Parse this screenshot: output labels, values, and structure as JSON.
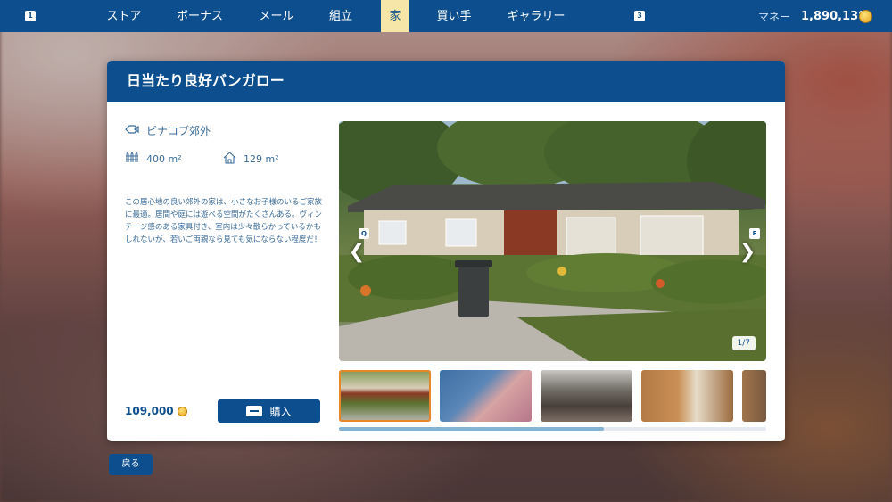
{
  "topbar": {
    "key_left": "1",
    "key_right": "3",
    "nav": [
      {
        "label": "ストア",
        "active": false
      },
      {
        "label": "ボーナス",
        "active": false
      },
      {
        "label": "メール",
        "active": false
      },
      {
        "label": "組立",
        "active": false
      },
      {
        "label": "家",
        "active": true
      },
      {
        "label": "買い手",
        "active": false
      },
      {
        "label": "ギャラリー",
        "active": false
      }
    ],
    "money_label": "マネー",
    "money_value": "1,890,138"
  },
  "dialog": {
    "title": "日当たり良好バンガロー",
    "location": "ピナコブ郊外",
    "plot_area": "400 m²",
    "house_area": "129 m²",
    "description": "この居心地の良い郊外の家は、小さなお子様のいるご家族に最適。居間や庭には遊べる空間がたくさんある。ヴィンテージ感のある家具付き、室内は少々散らかっているかもしれないが、若いご両親なら見ても気にならない程度だ！",
    "price": "109,000",
    "buy_label": "購入",
    "gallery": {
      "prev_key": "Q",
      "next_key": "E",
      "prev_arrow": "❮",
      "next_arrow": "❯",
      "counter": "1/7",
      "selected_index": 0,
      "scroll_fraction": 0.62
    }
  },
  "back_label": "戻る",
  "colors": {
    "primary": "#0d4f8e",
    "active_tab": "#f6e7a8",
    "thumb_selected": "#e8862a",
    "coin": "#e3a21a"
  },
  "icons": {
    "location": "fish-map-icon",
    "plot": "fence-icon",
    "house": "house-icon",
    "coin": "coin-icon",
    "buy_key": "space-key-icon"
  }
}
